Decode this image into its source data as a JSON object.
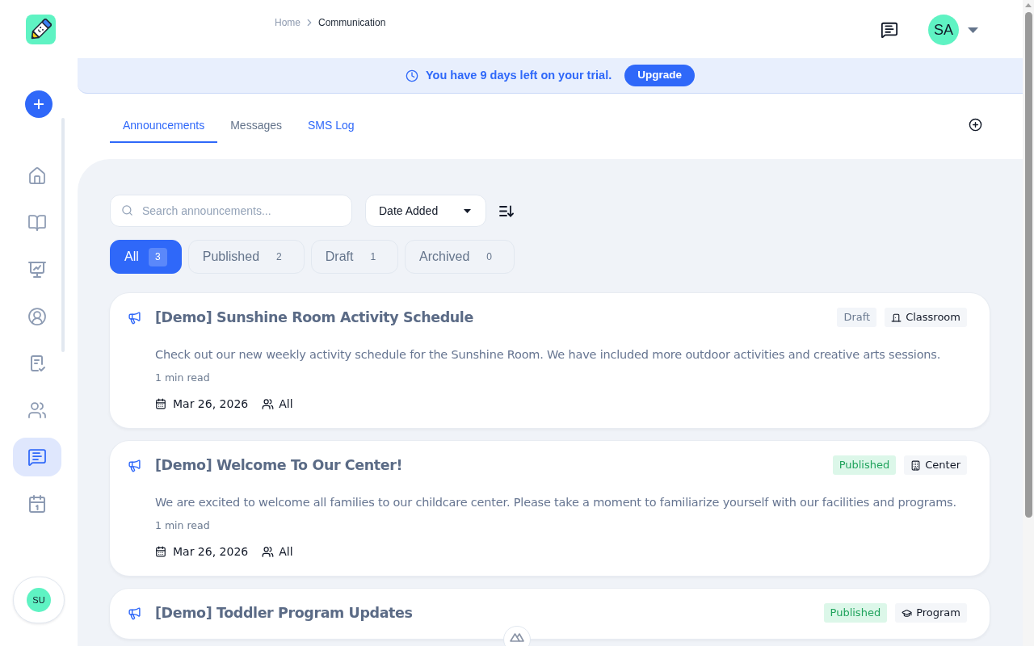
{
  "sidebar": {
    "nav_items": [
      {
        "selected": false
      },
      {
        "selected": false
      },
      {
        "selected": false
      },
      {
        "selected": false
      },
      {
        "selected": false
      },
      {
        "selected": false
      },
      {
        "selected": true
      },
      {
        "selected": false
      }
    ],
    "user_initials": "SU"
  },
  "header": {
    "breadcrumb": [
      "Home",
      "Communication"
    ],
    "user_initials": "SA"
  },
  "trial_banner": {
    "message": "You have 9 days left on your trial.",
    "button": "Upgrade"
  },
  "tabs": [
    {
      "label": "Announcements",
      "selected": true,
      "hovered": false
    },
    {
      "label": "Messages",
      "selected": false,
      "hovered": false
    },
    {
      "label": "SMS Log",
      "selected": false,
      "hovered": true
    }
  ],
  "toolbar": {
    "search": {
      "placeholder": "Search announcements..."
    },
    "sort": {
      "value": "Date Added"
    }
  },
  "filters": [
    {
      "label": "All",
      "count": "3",
      "selected": true
    },
    {
      "label": "Published",
      "count": "2",
      "selected": false
    },
    {
      "label": "Draft",
      "count": "1",
      "selected": false
    },
    {
      "label": "Archived",
      "count": "0",
      "selected": false
    }
  ],
  "announcements": [
    {
      "title": "[Demo] Sunshine Room Activity Schedule",
      "status": {
        "label": "Draft",
        "kind": "draft"
      },
      "category": {
        "label": "Classroom",
        "kind": "classroom"
      },
      "description": "Check out our new weekly activity schedule for the Sunshine Room. We have included more outdoor activities and creative arts sessions.",
      "read_time": "1 min read",
      "date": "Mar 26, 2026",
      "audience": "All"
    },
    {
      "title": "[Demo] Welcome To Our Center!",
      "status": {
        "label": "Published",
        "kind": "published"
      },
      "category": {
        "label": "Center",
        "kind": "center"
      },
      "description": "We are excited to welcome all families to our childcare center. Please take a moment to familiarize yourself with our facilities and programs.",
      "read_time": "1 min read",
      "date": "Mar 26, 2026",
      "audience": "All"
    },
    {
      "title": "[Demo] Toddler Program Updates",
      "status": {
        "label": "Published",
        "kind": "published"
      },
      "category": {
        "label": "Program",
        "kind": "program"
      }
    }
  ]
}
